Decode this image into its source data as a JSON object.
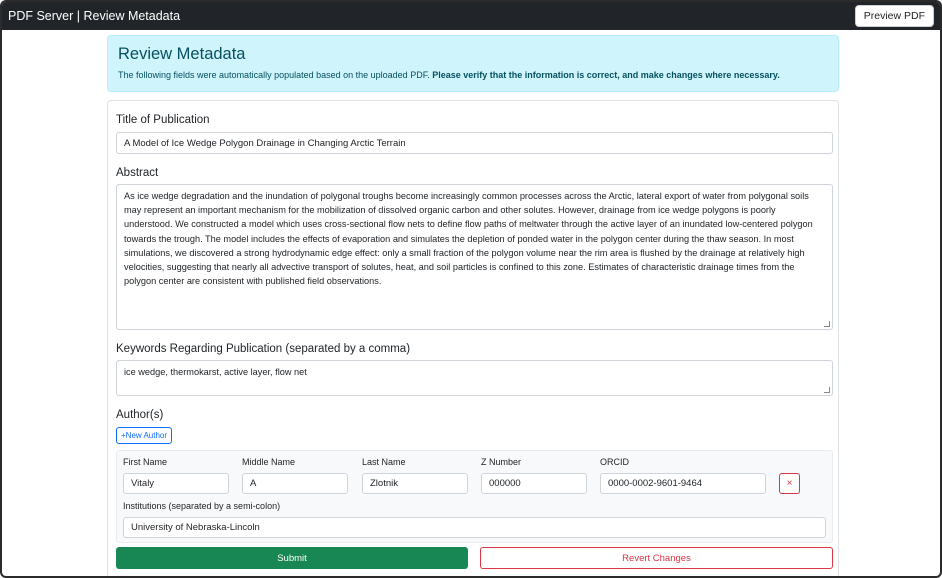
{
  "navbar": {
    "brand": "PDF Server | Review Metadata",
    "preview_label": "Preview PDF"
  },
  "alert": {
    "heading": "Review Metadata",
    "text": "The following fields were automatically populated based on the uploaded PDF.",
    "bold_text": "Please verify that the information is correct, and make changes where necessary."
  },
  "form": {
    "title_label": "Title of Publication",
    "title_value": "A Model of Ice Wedge Polygon Drainage in Changing Arctic Terrain",
    "abstract_label": "Abstract",
    "abstract_value": "As ice wedge degradation and the inundation of polygonal troughs become increasingly common processes across the Arctic, lateral export of water from polygonal soils may represent an important mechanism for the mobilization of dissolved organic carbon and other solutes. However, drainage from ice wedge polygons is poorly understood. We constructed a model which uses cross-sectional flow nets to define flow paths of meltwater through the active layer of an inundated low-centered polygon towards the trough. The model includes the effects of evaporation and simulates the depletion of ponded water in the polygon center during the thaw season. In most simulations, we discovered a strong hydrodynamic edge effect: only a small fraction of the polygon volume near the rim area is flushed by the drainage at relatively high velocities, suggesting that nearly all advective transport of solutes, heat, and soil particles is confined to this zone. Estimates of characteristic drainage times from the polygon center are consistent with published field observations.",
    "keywords_label": "Keywords Regarding Publication (separated by a comma)",
    "keywords_value": "ice wedge, thermokarst, active layer, flow net",
    "authors_label": "Author(s)",
    "new_author_label": "+New Author",
    "author_fields": {
      "first_name_label": "First Name",
      "middle_name_label": "Middle Name",
      "last_name_label": "Last Name",
      "z_number_label": "Z Number",
      "orcid_label": "ORCID",
      "institutions_label": "Institutions (separated by a semi-colon)"
    },
    "authors": [
      {
        "first_name": "Vitaly",
        "middle_name": "A",
        "last_name": "Zlotnik",
        "z_number": "000000",
        "orcid": "0000-0002-9601-9464",
        "institutions": "University of Nebraska-Lincoln",
        "remove_label": "×"
      }
    ],
    "submit_label": "Submit",
    "revert_label": "Revert Changes"
  }
}
